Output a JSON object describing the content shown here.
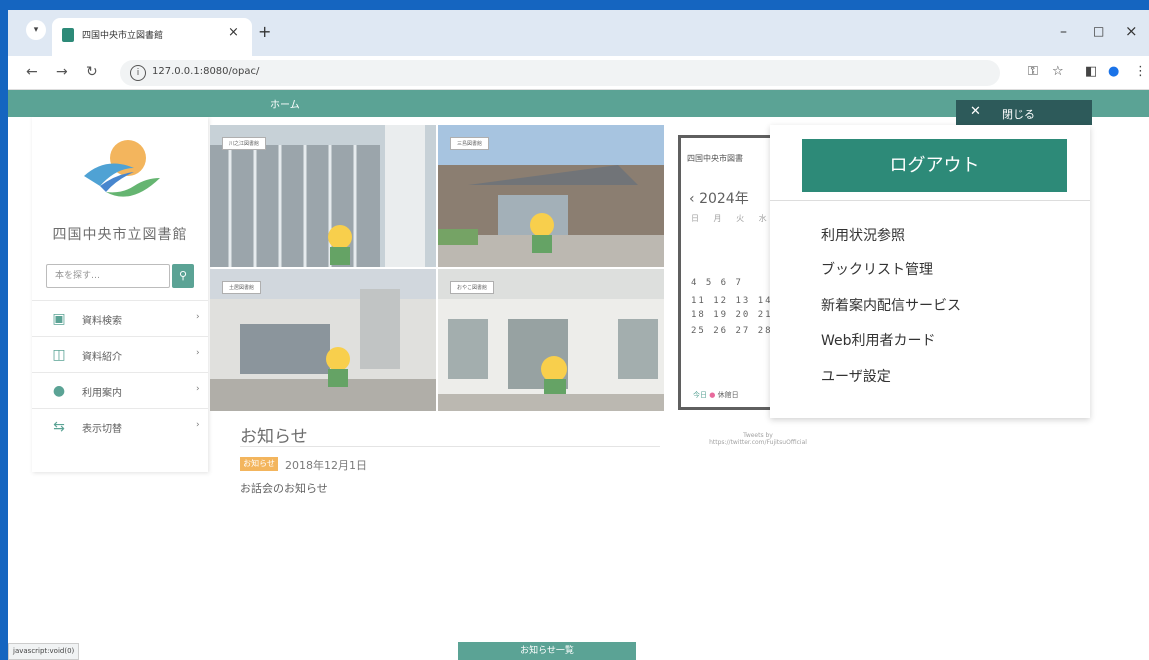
{
  "browser": {
    "tab_title": "四国中央市立図書館",
    "tab_close": "×",
    "new_tab": "+",
    "url": "127.0.0.1:8080/opac/",
    "window_min": "–",
    "window_max": "□",
    "window_close": "×"
  },
  "nav": {
    "home_label": "ホーム"
  },
  "sidebar": {
    "library_name": "四国中央市立図書館",
    "search_placeholder": "本を探す…",
    "items": [
      {
        "label": "資料検索",
        "icon": "book-search-icon"
      },
      {
        "label": "資料紹介",
        "icon": "open-book-icon"
      },
      {
        "label": "利用案内",
        "icon": "person-icon"
      },
      {
        "label": "表示切替",
        "icon": "switch-icon"
      }
    ]
  },
  "photos": [
    {
      "label": "川之江図書館"
    },
    {
      "label": "三島図書館"
    },
    {
      "label": "土居図書館"
    },
    {
      "label": "おやこ図書館"
    }
  ],
  "news": {
    "title": "お知らせ",
    "badge": "お知らせ",
    "date": "2018年12月1日",
    "text": "お話会のお知らせ",
    "more_button": "お知らせ一覧"
  },
  "calendar": {
    "header": "四国中央市図書",
    "year": "2024年",
    "weekdays": "日 月 火 水",
    "rows": [
      "4  5  6  7",
      "11 12 13 14",
      "18 19 20 21",
      "25 26 27 28"
    ],
    "legend_today": "今日",
    "legend_closed": "休館日"
  },
  "tweets": {
    "line1": "Tweets by",
    "line2": "https://twitter.com/FujitsuOfficial"
  },
  "status_url": "javascript:void(0)",
  "panel": {
    "close_label": "閉じる",
    "logout_label": "ログアウト",
    "links": [
      "利用状況参照",
      "ブックリスト管理",
      "新着案内配信サービス",
      "Web利用者カード",
      "ユーザ設定"
    ]
  },
  "colors": {
    "accent": "#2d8a78",
    "close_bar": "#2d5a5a",
    "badge": "#f0a030",
    "desktop": "#1565c0"
  }
}
